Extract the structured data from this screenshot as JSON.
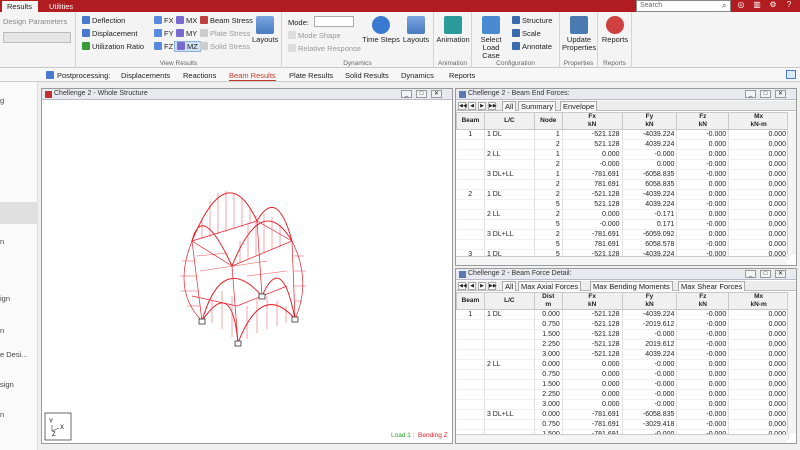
{
  "topbar": {
    "tabs": [
      "Results",
      "Utilities"
    ],
    "search_placeholder": "Search"
  },
  "ribbon": {
    "design_params": {
      "label": "Design Parameters"
    },
    "view_results": {
      "col1": [
        "Deflection",
        "Displacement",
        "Utilization Ratio"
      ],
      "col2": [
        "FX",
        "FY",
        "FZ"
      ],
      "col3": [
        "MX",
        "MY",
        "MZ"
      ],
      "col4": [
        "Beam Stress",
        "Plate Stress",
        "Solid Stress"
      ],
      "layouts": "Layouts",
      "label": "View Results"
    },
    "dynamics": {
      "mode_label": "Mode:",
      "mode_shape": "Mode Shape",
      "relative_response": "Relative Response",
      "time_steps": "Time Steps",
      "layouts": "Layouts",
      "label": "Dynamics"
    },
    "animation": {
      "button": "Animation",
      "label": "Animation"
    },
    "configuration": {
      "select_load_case": "Select Load Case",
      "structure": "Structure",
      "scale": "Scale",
      "annotate": "Annotate",
      "label": "Configuration"
    },
    "properties": {
      "update": "Update Properties",
      "label": "Properties"
    },
    "reports": {
      "button": "Reports",
      "label": "Reports"
    }
  },
  "subnav": {
    "prefix": "Postprocessing:",
    "items": [
      "Displacements",
      "Reactions",
      "Beam Results",
      "Plate Results",
      "Solid Results",
      "Dynamics",
      "Reports"
    ],
    "active": "Beam Results"
  },
  "leftpanel": {
    "items": [
      "g",
      "n",
      "ign",
      "n",
      "e Desi...",
      "sign",
      "n"
    ]
  },
  "structure_window": {
    "title": "Chellenge 2 - Whole Structure",
    "legend_load": "Load 1 :",
    "legend_bending": "Bending Z",
    "axis_y": "Y",
    "axis_x": "X",
    "axis_z": "Z"
  },
  "end_forces": {
    "title": "Chellenge 2 - Beam End Forces:",
    "tabs": [
      "All",
      "Summary",
      "Envelope"
    ],
    "headers": [
      [
        "Beam",
        ""
      ],
      [
        "L/C",
        ""
      ],
      [
        "Node",
        ""
      ],
      [
        "Fx",
        "kN"
      ],
      [
        "Fy",
        "kN"
      ],
      [
        "Fz",
        "kN"
      ],
      [
        "Mx",
        "kN-m"
      ]
    ],
    "rows": [
      [
        "1",
        "1 DL",
        "1",
        "-521.128",
        "-4039.224",
        "-0.000",
        "0.000"
      ],
      [
        "",
        "",
        "2",
        "521.128",
        "4039.224",
        "0.000",
        "0.000"
      ],
      [
        "",
        "2 LL",
        "1",
        "0.000",
        "-0.000",
        "0.000",
        "0.000"
      ],
      [
        "",
        "",
        "2",
        "-0.000",
        "0.000",
        "-0.000",
        "0.000"
      ],
      [
        "",
        "3 DL+LL",
        "1",
        "-781.691",
        "-6058.835",
        "-0.000",
        "0.000"
      ],
      [
        "",
        "",
        "2",
        "781.691",
        "6058.835",
        "0.000",
        "0.000"
      ],
      [
        "2",
        "1 DL",
        "2",
        "-521.128",
        "-4039.224",
        "0.000",
        "0.000"
      ],
      [
        "",
        "",
        "5",
        "521.128",
        "4039.224",
        "-0.000",
        "0.000"
      ],
      [
        "",
        "2 LL",
        "2",
        "0.000",
        "-0.171",
        "0.000",
        "0.000"
      ],
      [
        "",
        "",
        "5",
        "-0.000",
        "0.171",
        "-0.000",
        "0.000"
      ],
      [
        "",
        "3 DL+LL",
        "2",
        "-781.691",
        "-6059.092",
        "0.000",
        "0.000"
      ],
      [
        "",
        "",
        "5",
        "781.691",
        "6058.578",
        "-0.000",
        "0.000"
      ],
      [
        "3",
        "1 DL",
        "5",
        "-521.128",
        "-4039.224",
        "-0.000",
        "0.000"
      ]
    ]
  },
  "force_detail": {
    "title": "Chellenge 2 - Beam Force Detail:",
    "tabs": [
      "All",
      "Max Axial Forces",
      "Max Bending Moments",
      "Max Shear Forces"
    ],
    "headers": [
      [
        "Beam",
        ""
      ],
      [
        "L/C",
        ""
      ],
      [
        "Dist",
        "m"
      ],
      [
        "Fx",
        "kN"
      ],
      [
        "Fy",
        "kN"
      ],
      [
        "Fz",
        "kN"
      ],
      [
        "Mx",
        "kN-m"
      ]
    ],
    "rows": [
      [
        "1",
        "1 DL",
        "0.000",
        "-521.128",
        "-4039.224",
        "-0.000",
        "0.000"
      ],
      [
        "",
        "",
        "0.750",
        "-521.128",
        "-2019.612",
        "-0.000",
        "0.000"
      ],
      [
        "",
        "",
        "1.500",
        "-521.128",
        "-0.000",
        "-0.000",
        "0.000"
      ],
      [
        "",
        "",
        "2.250",
        "-521.128",
        "2019.612",
        "-0.000",
        "0.000"
      ],
      [
        "",
        "",
        "3.000",
        "-521.128",
        "4039.224",
        "-0.000",
        "0.000"
      ],
      [
        "",
        "2 LL",
        "0.000",
        "0.000",
        "-0.000",
        "0.000",
        "0.000"
      ],
      [
        "",
        "",
        "0.750",
        "0.000",
        "-0.000",
        "0.000",
        "0.000"
      ],
      [
        "",
        "",
        "1.500",
        "0.000",
        "-0.000",
        "0.000",
        "0.000"
      ],
      [
        "",
        "",
        "2.250",
        "0.000",
        "-0.000",
        "0.000",
        "0.000"
      ],
      [
        "",
        "",
        "3.000",
        "0.000",
        "-0.000",
        "0.000",
        "0.000"
      ],
      [
        "",
        "3 DL+LL",
        "0.000",
        "-781.691",
        "-6058.835",
        "-0.000",
        "0.000"
      ],
      [
        "",
        "",
        "0.750",
        "-781.691",
        "-3029.418",
        "-0.000",
        "0.000"
      ],
      [
        "",
        "",
        "1.500",
        "-781.691",
        "-0.000",
        "-0.000",
        "0.000"
      ]
    ]
  },
  "colors": {
    "brand": "#b01c20",
    "bending": "#e8202a",
    "load": "#22aa22"
  }
}
